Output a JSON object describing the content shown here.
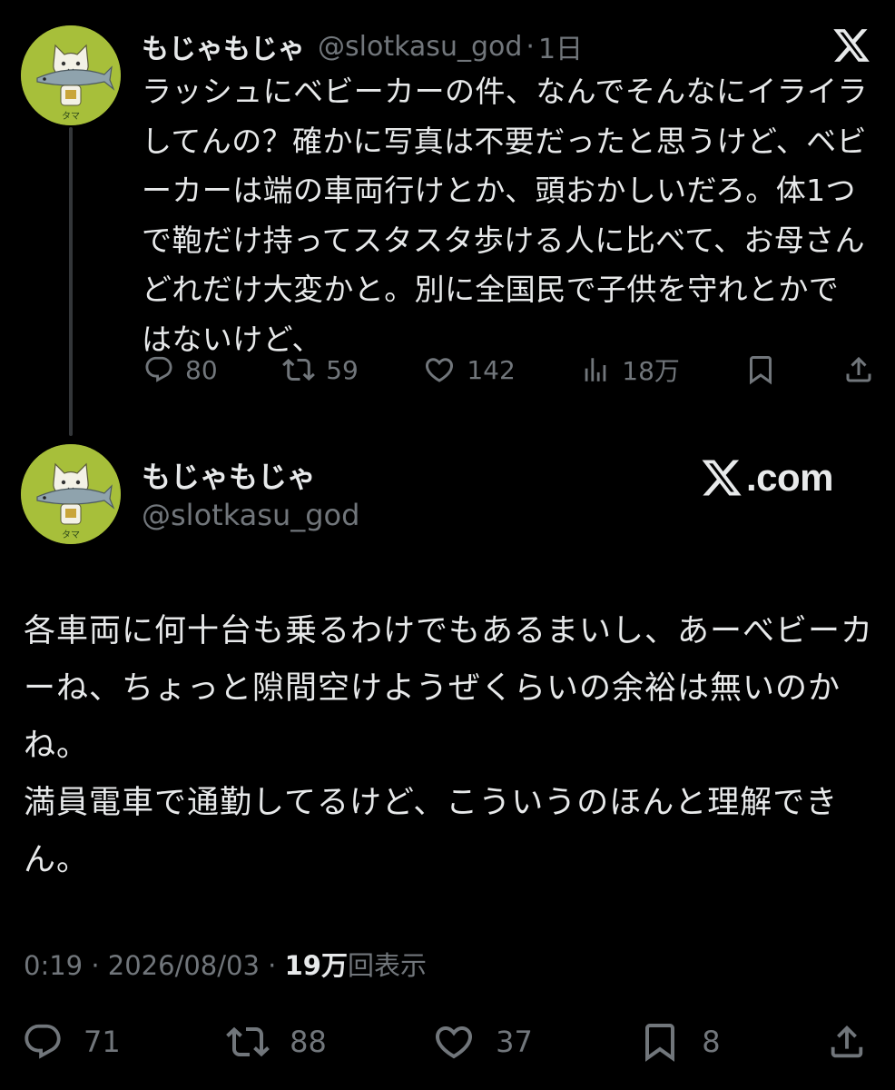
{
  "thread_tweet": {
    "author_name": "もじゃもじゃ",
    "handle": "@slotkasu_god",
    "separator": "·",
    "time": "1日",
    "text": "ラッシュにベビーカーの件、なんでそんなにイライラしてんの？確かに写真は不要だったと思うけど、ベビーカーは端の車両行けとか、頭おかしいだろ。体1つで鞄だけ持ってスタスタ歩ける人に比べて、お母さんどれだけ大変かと。別に全国民で子供を守れとかではないけど、",
    "replies": "80",
    "reposts": "59",
    "likes": "142",
    "views": "18万",
    "icons": [
      "reply-icon",
      "repost-icon",
      "like-icon",
      "views-icon",
      "bookmark-icon",
      "share-icon"
    ]
  },
  "main_tweet": {
    "author_name": "もじゃもじゃ",
    "handle": "@slotkasu_god",
    "brand": ".com",
    "text_lines": [
      "各車両に何十台も乗るわけでもあるまいし、あーべビーカーね、ちょっと隙間空けようぜくらいの余裕は無いのかね。",
      "満員電車で通勤してるけど、こういうのほんと理解できん。"
    ],
    "time": "0:19",
    "date": "2026/08/03",
    "views_count": "19万",
    "views_label": "回表示",
    "replies": "71",
    "reposts": "88",
    "likes": "37",
    "bookmarks": "8"
  },
  "colors": {
    "background": "#000000",
    "text_primary": "#e7e9ea",
    "text_secondary": "#71767b",
    "avatar_green": "#a7bf3a",
    "thread_line": "#333639"
  }
}
